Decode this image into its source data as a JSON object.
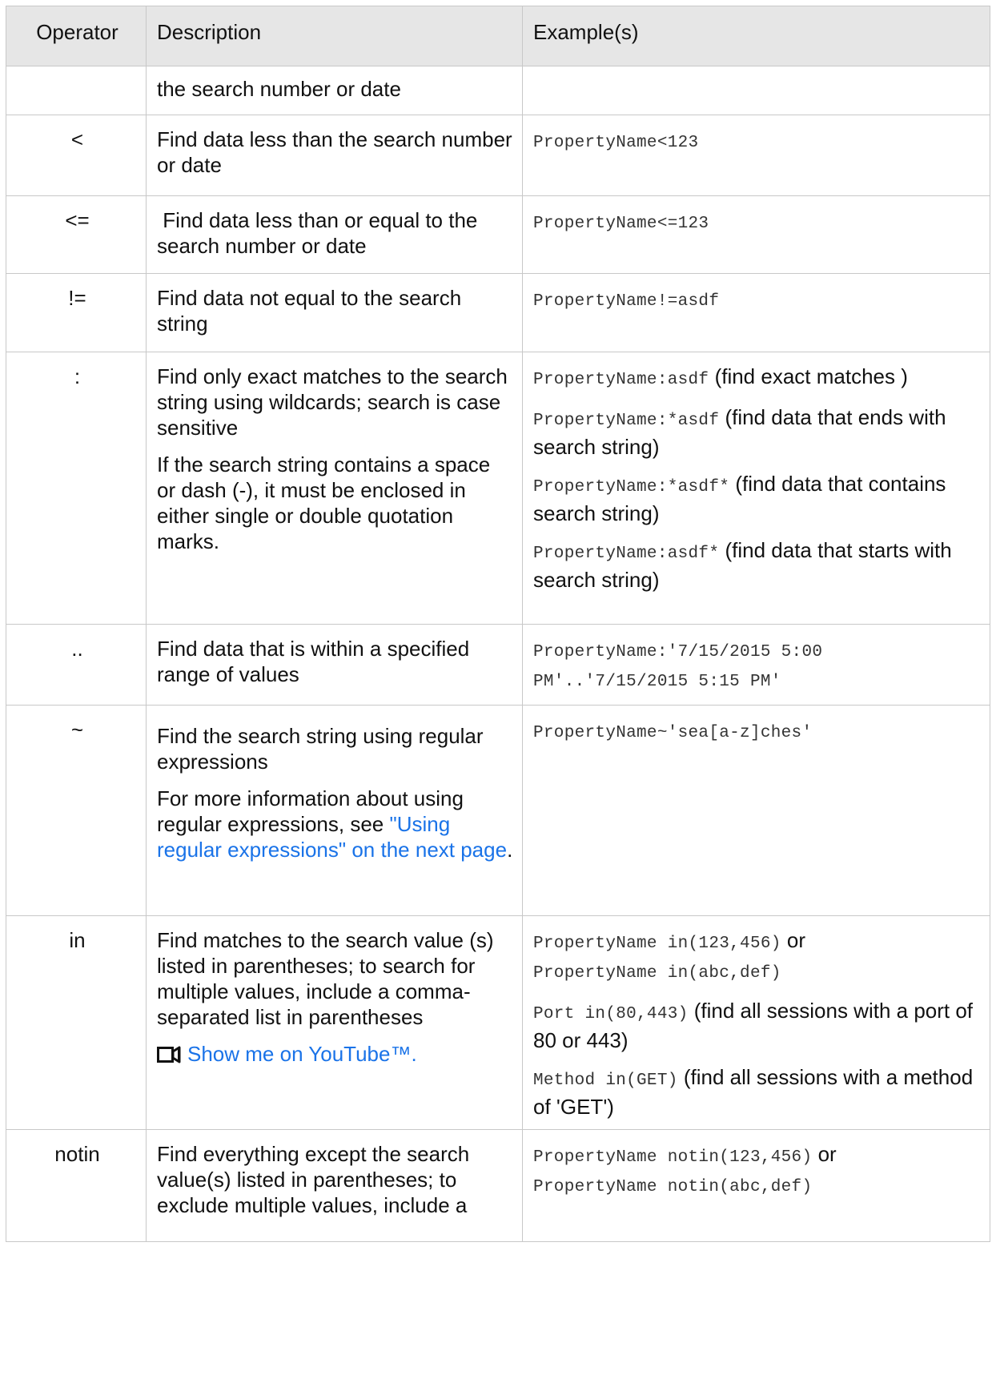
{
  "headers": [
    "Operator",
    "Description",
    "Example(s)"
  ],
  "rows": [
    {
      "op": "",
      "desc": [
        "the search number or date"
      ],
      "ex": []
    },
    {
      "op": "<",
      "desc": [
        "Find data less than the search number or date"
      ],
      "ex": [
        {
          "code": "PropertyName<123",
          "text": ""
        }
      ]
    },
    {
      "op": "<=",
      "desc": [
        " Find data less than or equal to the search number or date"
      ],
      "ex": [
        {
          "code": "PropertyName<=123",
          "text": ""
        }
      ]
    },
    {
      "op": "!=",
      "desc": [
        "Find data not equal to the search string"
      ],
      "ex": [
        {
          "code": "PropertyName!=asdf",
          "text": ""
        }
      ]
    },
    {
      "op": ":",
      "desc": [
        "Find only exact matches to the search string using wildcards; search is case sensitive",
        "If the search string contains a space or dash (-), it must be enclosed in either single or double quotation marks."
      ],
      "ex": [
        {
          "code": "PropertyName:asdf",
          "text": " (find exact matches )"
        },
        {
          "code": "PropertyName:*asdf",
          "text": " (find data that ends with search string)"
        },
        {
          "code": "PropertyName:*asdf*",
          "text": " (find data that contains search string)"
        },
        {
          "code": "PropertyName:asdf*",
          "text": " (find data that starts with search string)"
        }
      ]
    },
    {
      "op": "..",
      "desc": [
        "Find data that is within a specified range of values"
      ],
      "ex": [
        {
          "code": "PropertyName:'7/15/2015 5:00 PM'..'7/15/2015 5:15 PM'",
          "text": ""
        }
      ]
    },
    {
      "op": "~",
      "desc": [
        "Find the search string using regular expressions"
      ],
      "desc_more_prefix": "For more information about using regular expressions, see ",
      "desc_link": "\"Using regular expressions\" on the next page",
      "desc_more_suffix": ".",
      "ex": [
        {
          "code": "PropertyName~'sea[a-z]ches'",
          "text": ""
        }
      ]
    },
    {
      "op": "in",
      "desc": [
        "Find matches to the search value (s) listed in parentheses; to search for multiple values, include a comma-separated list in parentheses"
      ],
      "video_link": "Show me on YouTube™.",
      "video_icon": "video-camera-icon",
      "ex_first": {
        "code1": "PropertyName in(123,456)",
        "or": " or ",
        "code2": "PropertyName in(abc,def)"
      },
      "ex": [
        {
          "code": "Port in(80,443)",
          "text": " (find all sessions with a port of 80 or 443)"
        },
        {
          "code": "Method in(GET)",
          "text": " (find all sessions with a method of 'GET')"
        }
      ]
    },
    {
      "op": "notin",
      "desc": [
        "Find everything except the search value(s) listed in parentheses; to exclude multiple values, include a"
      ],
      "ex_first": {
        "code1": "PropertyName notin(123,456)",
        "or": " or ",
        "code2": "PropertyName notin(abc,def)"
      }
    }
  ],
  "colors": {
    "header_bg": "#e6e6e6",
    "border": "#c8c8c8",
    "link": "#1a73e8"
  }
}
